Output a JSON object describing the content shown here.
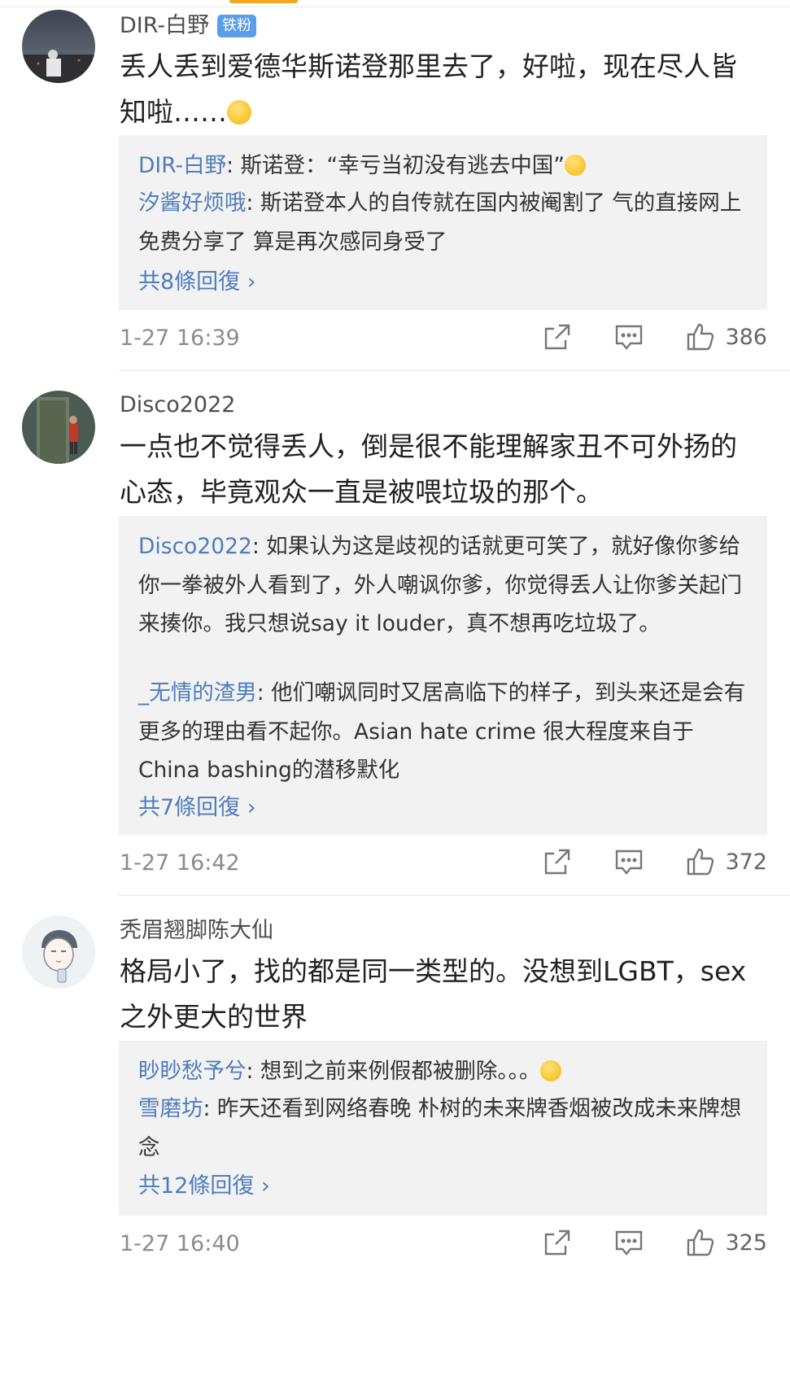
{
  "comments": [
    {
      "user": "DIR-白野",
      "badge": "铁粉",
      "text_pre": "丢人丢到爱德华斯诺登那里去了，好啦，现在尽人皆知啦……",
      "emoji": "sweat-emoji",
      "replies": [
        {
          "name": "DIR-白野",
          "sep": ": ",
          "text": "斯诺登：“幸亏当初没有逃去中国”",
          "emoji": "doge-emoji"
        },
        {
          "name": "汐酱好烦哦",
          "sep": ": ",
          "text": "斯诺登本人的自传就在国内被阉割了 气的直接网上免费分享了 算是再次感同身受了"
        }
      ],
      "more": "共8條回復 ›",
      "time": "1-27 16:39",
      "likes": "386"
    },
    {
      "user": "Disco2022",
      "text_pre": "一点也不觉得丢人，倒是很不能理解家丑不可外扬的心态，毕竟观众一直是被喂垃圾的那个。",
      "replies": [
        {
          "name": "Disco2022",
          "sep": ": ",
          "text": "如果认为这是歧视的话就更可笑了，就好像你爹给你一拳被外人看到了，外人嘲讽你爹，你觉得丢人让你爹关起门来揍你。我只想说say it louder，真不想再吃垃圾了。"
        },
        {
          "name": "_无情的渣男",
          "sep": ": ",
          "text": "他们嘲讽同时又居高临下的样子，到头来还是会有更多的理由看不起你。Asian hate crime 很大程度来自于China bashing的潜移默化"
        }
      ],
      "more": "共7條回復 ›",
      "time": "1-27 16:42",
      "likes": "372"
    },
    {
      "user": "秃眉翘脚陈大仙",
      "text_pre": "格局小了，找的都是同一类型的。没想到LGBT，sex之外更大的世界",
      "replies": [
        {
          "name": "眇眇愁予兮",
          "sep": ": ",
          "text": "想到之前来例假都被删除。。。",
          "emoji": "laugh-cry-emoji"
        },
        {
          "name": "雪磨坊",
          "sep": ": ",
          "text": "昨天还看到网络春晚 朴树的未来牌香烟被改成未来牌想念"
        }
      ],
      "more": "共12條回復 ›",
      "time": "1-27 16:40",
      "likes": "325"
    }
  ],
  "icons": {
    "share": "share-icon",
    "comment": "comment-icon",
    "like": "thumbs-up-icon"
  },
  "colors": {
    "link": "#4f7cbc",
    "badge": "#5b9ee8",
    "reply_bg": "#f2f2f2"
  }
}
